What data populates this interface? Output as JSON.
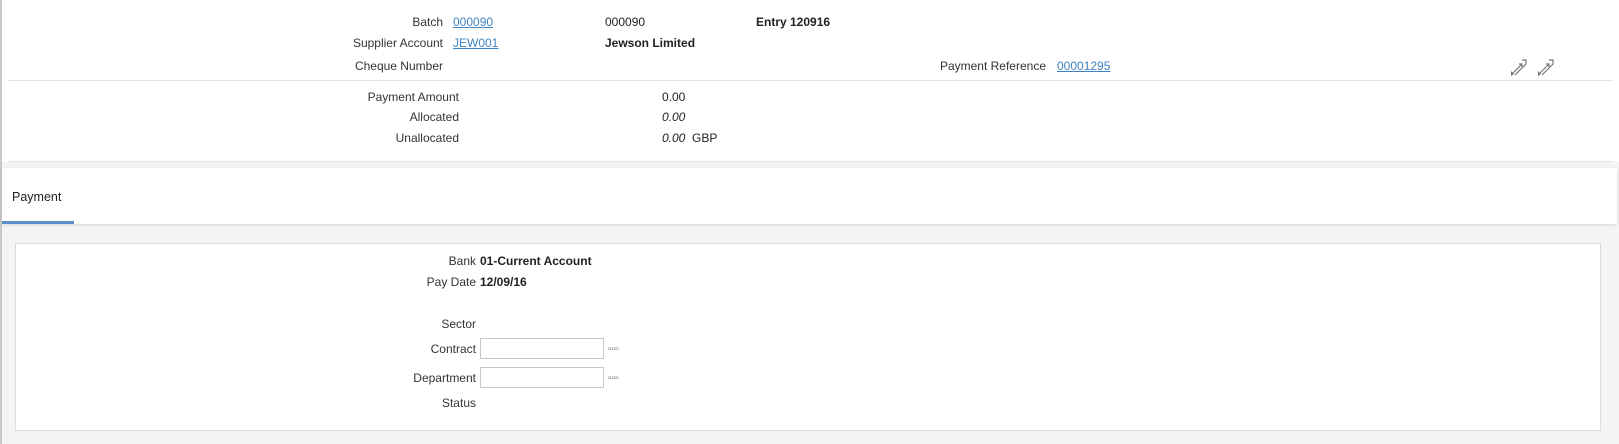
{
  "header": {
    "batch": {
      "label": "Batch",
      "link": "000090",
      "value": "000090",
      "entry": "Entry 120916"
    },
    "supplier": {
      "label": "Supplier Account",
      "link": "JEW001",
      "name": "Jewson Limited"
    },
    "cheque": {
      "label": "Cheque Number",
      "value": ""
    },
    "payment_reference": {
      "label": "Payment Reference",
      "link": "00001295"
    },
    "amounts": {
      "payment_label": "Payment Amount",
      "payment_value": "0.00",
      "allocated_label": "Allocated",
      "allocated_value": "0.00",
      "unallocated_label": "Unallocated",
      "unallocated_value": "0.00",
      "currency": "GBP"
    },
    "icons": [
      "expand-icon",
      "expand-icon"
    ]
  },
  "tabs": [
    {
      "label": "Payment",
      "active": true
    }
  ],
  "payment_panel": {
    "bank": {
      "label": "Bank",
      "value": "01-Current Account"
    },
    "pay_date": {
      "label": "Pay Date",
      "value": "12/09/16"
    },
    "sector": {
      "label": "Sector",
      "value": ""
    },
    "contract": {
      "label": "Contract",
      "value": "",
      "lookup": "▫▫▫"
    },
    "department": {
      "label": "Department",
      "value": "",
      "lookup": "▫▫▫"
    },
    "status": {
      "label": "Status",
      "value": ""
    }
  },
  "colors": {
    "link": "#3f83c3",
    "accent": "#e8772e",
    "tab_underline": "#5b8fc7"
  }
}
